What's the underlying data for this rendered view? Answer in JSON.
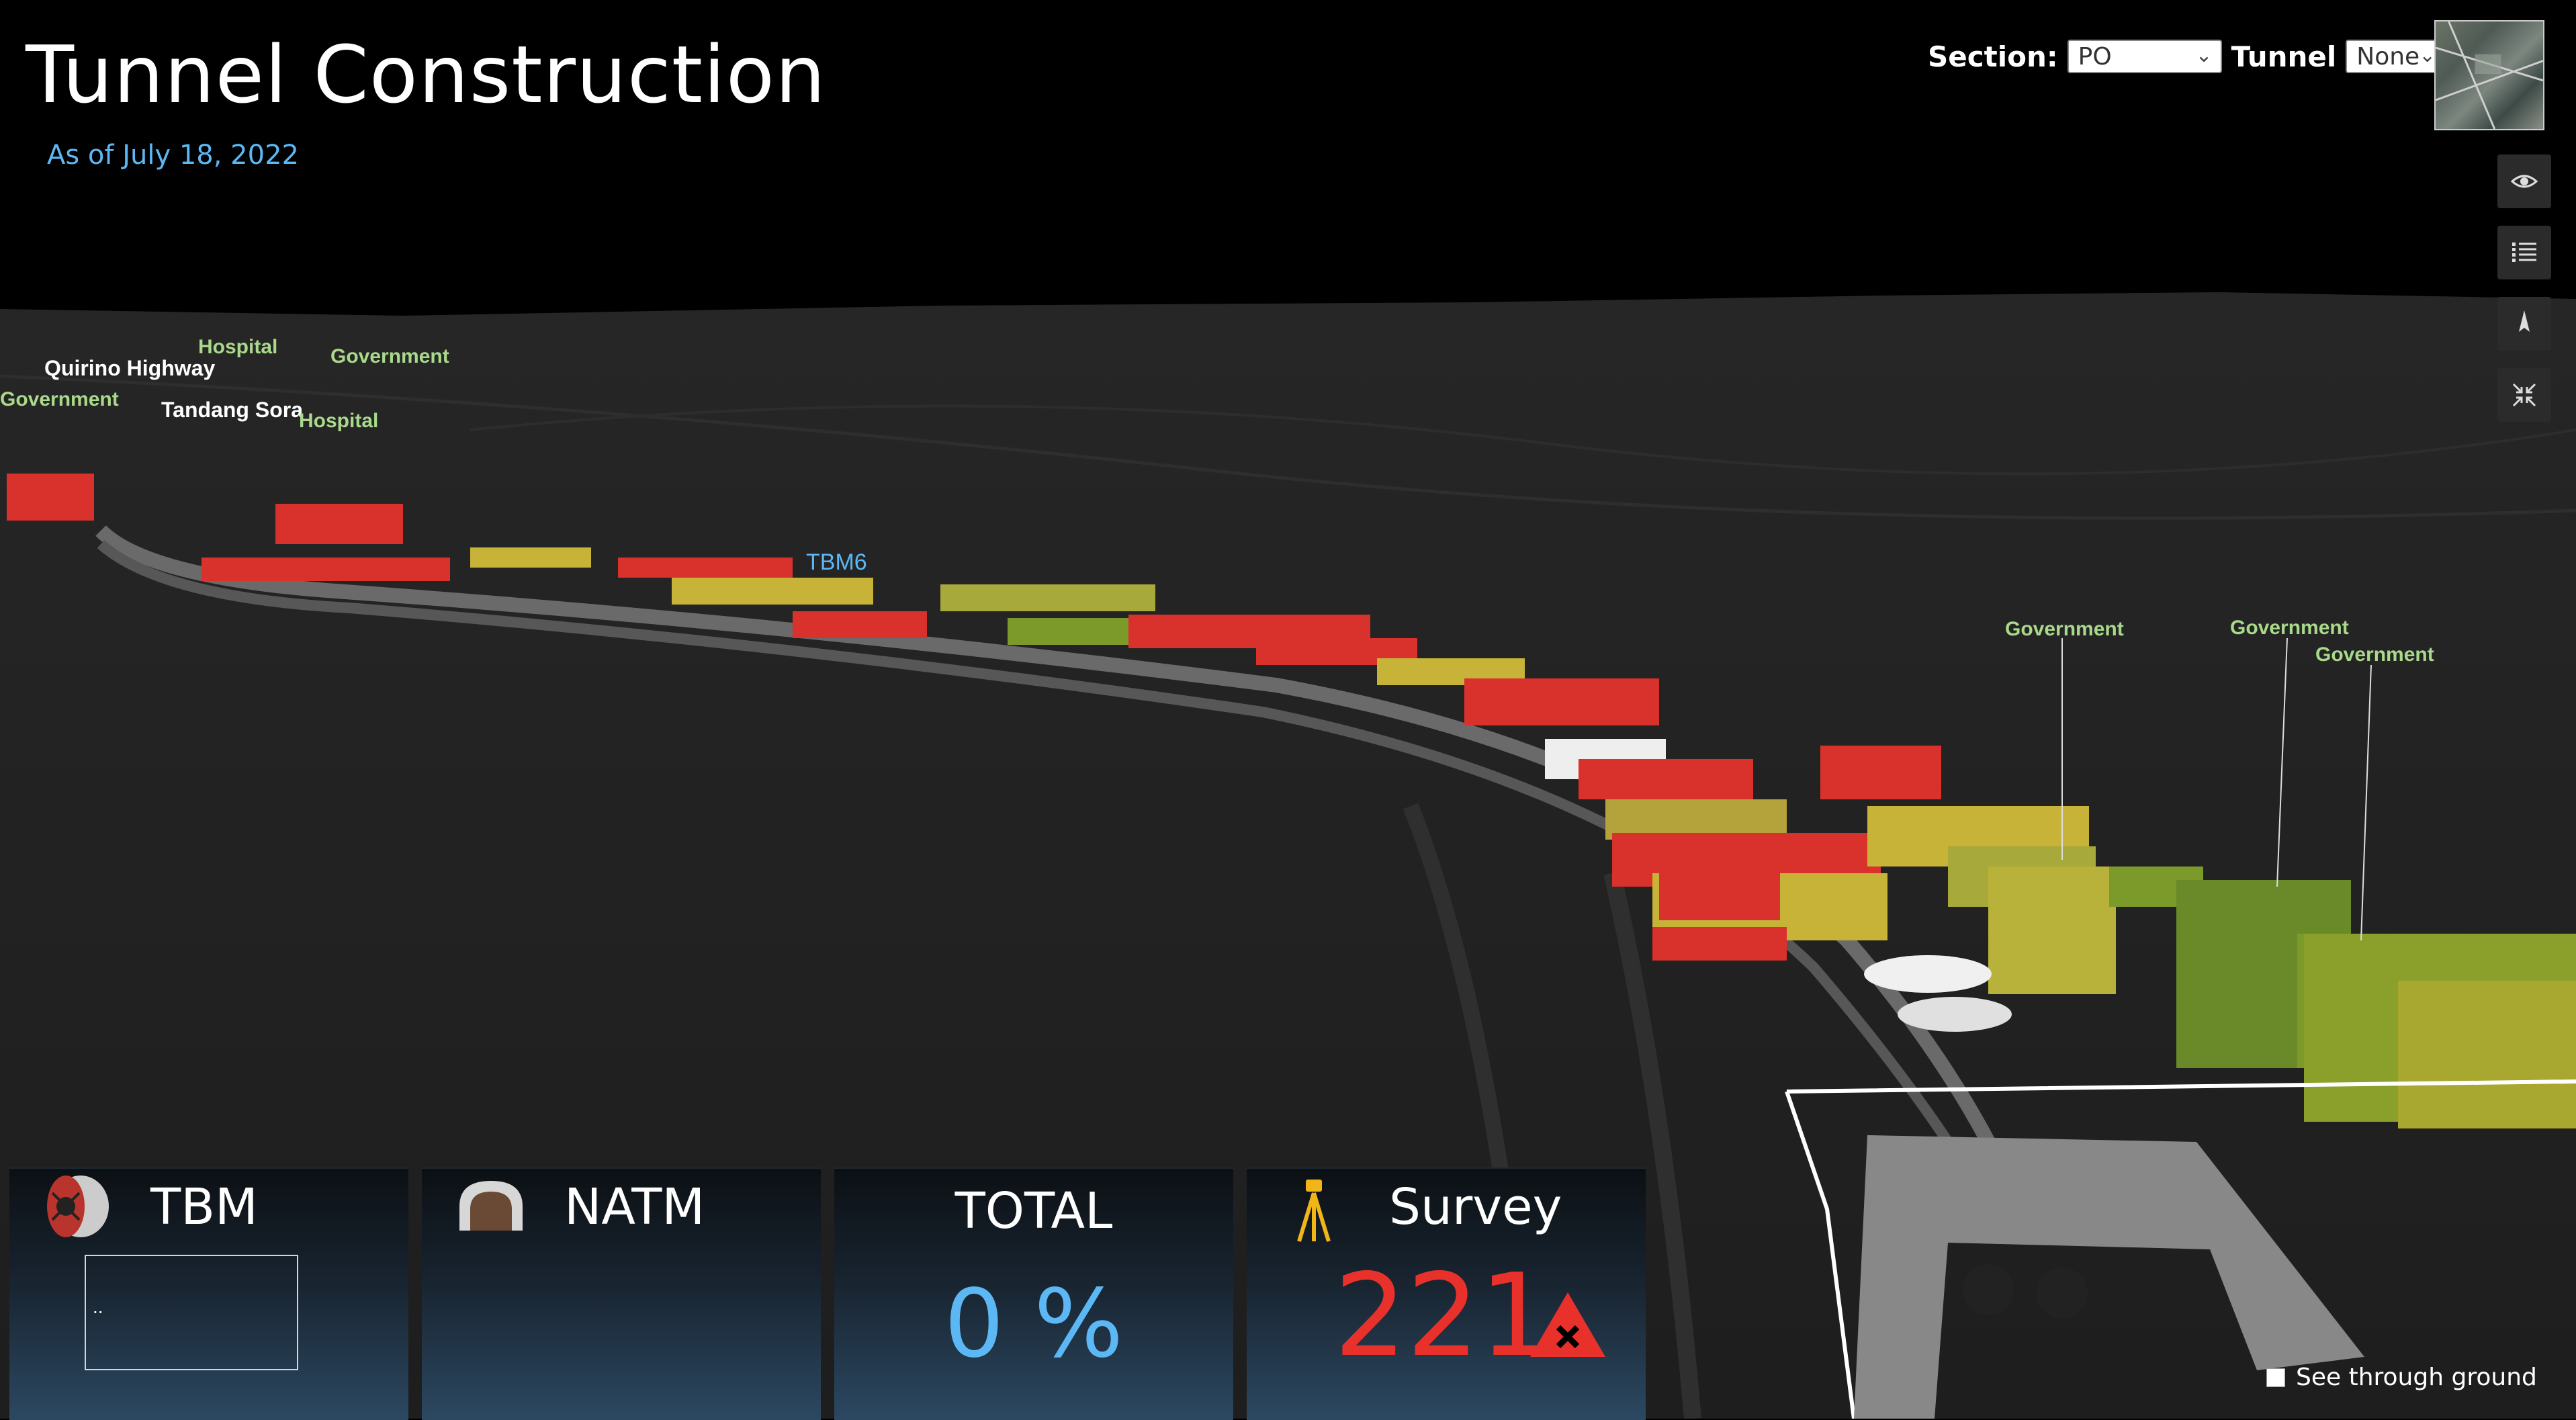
{
  "header": {
    "title": "Tunnel Construction",
    "subtitle": "As of July 18, 2022"
  },
  "filters": {
    "section_label": "Section:",
    "section_value": "PO",
    "tunnel_label": "Tunnel",
    "tunnel_value": "None"
  },
  "map_labels": {
    "hospital_1": "Hospital",
    "government_1": "Government",
    "quirino": "Quirino Highway",
    "government_2": "Government",
    "tandang_sora": "Tandang Sora",
    "hospital_2": "Hospital",
    "tbm6": "TBM6",
    "government_3": "Government",
    "government_4": "Government",
    "government_5": "Government"
  },
  "panels": {
    "tbm": {
      "label": "TBM",
      "box_text": ".."
    },
    "natm": {
      "label": "NATM"
    },
    "total": {
      "label": "TOTAL",
      "value": "0 %"
    },
    "survey": {
      "label": "Survey",
      "value": "221"
    }
  },
  "options": {
    "see_through_label": "See through ground"
  },
  "colors": {
    "accent_blue": "#5cb8f5",
    "alert_red": "#e8312b",
    "building_red": "#d9312c",
    "building_yellow": "#c7b338",
    "building_green": "#7b9a2a"
  },
  "icons": {
    "visibility": "eye-icon",
    "legend": "list-icon",
    "compass": "compass-icon",
    "fullscreen": "collapse-icon",
    "tbm": "tunnel-boring-machine-icon",
    "natm": "tunnel-shell-icon",
    "survey": "survey-tripod-icon",
    "alert": "warning-triangle-icon"
  }
}
